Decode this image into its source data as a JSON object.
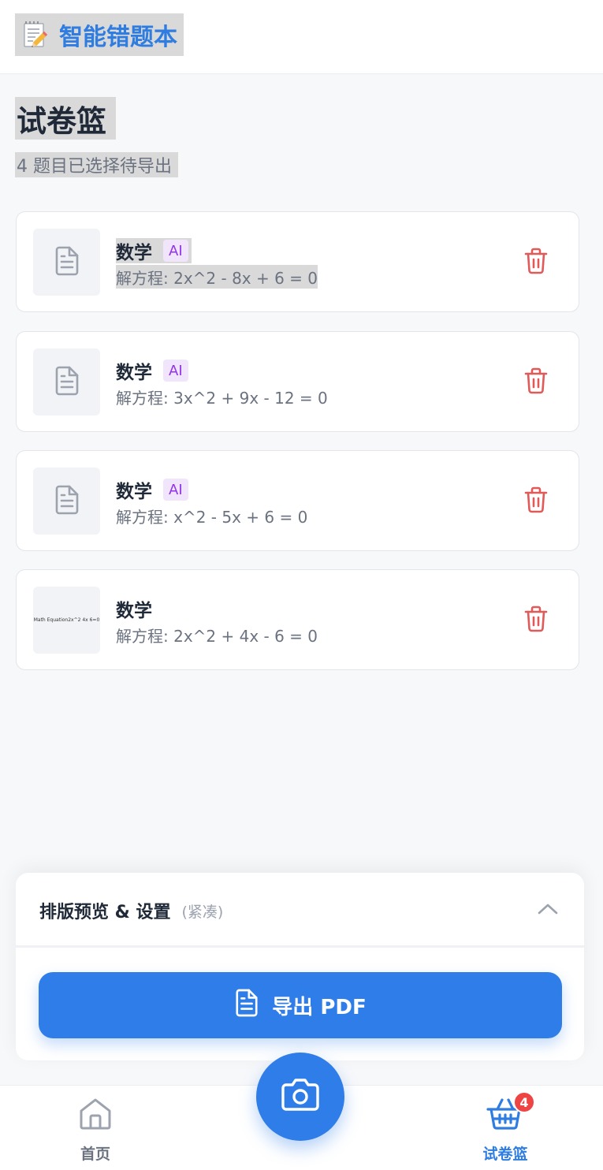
{
  "header": {
    "app_title": "智能错题本",
    "logo_icon": "memo-pencil-icon"
  },
  "page": {
    "title": "试卷篮",
    "subtitle": "4 题目已选择待导出"
  },
  "items": [
    {
      "subject": "数学",
      "ai_badge": "AI",
      "question": "解方程: 2x^2 - 8x + 6 = 0",
      "thumb_icon": "document-icon",
      "thumb_text": ""
    },
    {
      "subject": "数学",
      "ai_badge": "AI",
      "question": "解方程: 3x^2 + 9x - 12 = 0",
      "thumb_icon": "document-icon",
      "thumb_text": ""
    },
    {
      "subject": "数学",
      "ai_badge": "AI",
      "question": "解方程: x^2 - 5x + 6 = 0",
      "thumb_icon": "document-icon",
      "thumb_text": ""
    },
    {
      "subject": "数学",
      "ai_badge": "",
      "question": "解方程: 2x^2 + 4x - 6 = 0",
      "thumb_icon": "",
      "thumb_text": "Math Equation2x^2 4x 6=0"
    }
  ],
  "settings_panel": {
    "title": "排版预览 & 设置",
    "mode": "(紧凑)",
    "toggle_icon": "chevron-up-icon",
    "export_label": "导出 PDF",
    "export_icon": "document-icon"
  },
  "bottom_nav": {
    "home_label": "首页",
    "basket_label": "试卷篮",
    "basket_count": "4",
    "camera_icon": "camera-icon"
  },
  "colors": {
    "primary": "#2f7de8",
    "delete": "#e05a5a",
    "ai_badge_bg": "#f1e5fb",
    "ai_badge_text": "#9333ea",
    "badge": "#ef4444"
  }
}
